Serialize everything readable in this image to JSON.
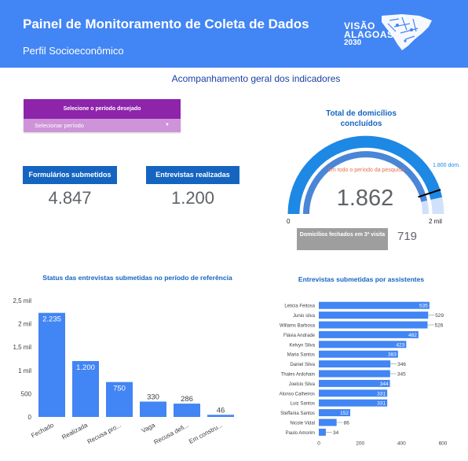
{
  "header": {
    "title": "Painel de Monitoramento de Coleta de Dados",
    "subtitle": "Perfil Socioeconômico",
    "logo_line1": "VISÃO",
    "logo_line2": "ALAGOAS",
    "logo_line3": "2030"
  },
  "main": {
    "section_title": "Acompanhamento geral dos indicadores",
    "period": {
      "heading": "Selecione o período desejado",
      "select_value": "Selecionar período"
    },
    "kpis": [
      {
        "label": "Formulários submetidos",
        "value": "4.847"
      },
      {
        "label": "Entrevistas realizadas",
        "value": "1.200"
      }
    ],
    "gauge": {
      "title": "Total de domicílios concluídos",
      "subtitle": "Em todo o período da pesquisa",
      "value": "1.862",
      "min_label": "0",
      "max_label": "2 mil",
      "target_label": "1.800 dom.",
      "current": 1862,
      "max": 2000,
      "target": 1800,
      "colors": {
        "track": "#d0e2fb",
        "fill": "#1e88e5",
        "inner_track": "#cfe0fa",
        "inner_fill": "#4a86d8"
      }
    },
    "closed_third_visit": {
      "label": "Domicílios fechados em 3ª visita",
      "value": "719"
    }
  },
  "chart_data": [
    {
      "type": "bar",
      "title": "Status das entrevistas submetidas no período de referência",
      "categories": [
        "Fechado",
        "Realizada",
        "Recusa pro...",
        "Vaga",
        "Recusa defi...",
        "Em constru..."
      ],
      "values": [
        2235,
        1200,
        750,
        330,
        286,
        46
      ],
      "value_labels": [
        "2.235",
        "1.200",
        "750",
        "330",
        "286",
        "46"
      ],
      "ytick_labels": [
        "0",
        "500",
        "1 mil",
        "1,5 mil",
        "2 mil",
        "2,5 mil"
      ],
      "yticks": [
        0,
        500,
        1000,
        1500,
        2000,
        2500
      ],
      "ylim": [
        0,
        2500
      ],
      "color": "#4285f4",
      "grid": false
    },
    {
      "type": "bar",
      "orientation": "horizontal",
      "title": "Entrevistas submetidas por assistentes",
      "categories": [
        "Leticia Feitosa",
        "Junio silva",
        "Willams Barbosa",
        "Flávia Andrade",
        "Kelvyn Silva",
        "Maria Santos",
        "Daniel Silva",
        "Thales Ardohain",
        "Joelcio Silva",
        "Alonso Calheiros",
        "Luiz Santos",
        "Steffania Santos",
        "Nicole Vidal",
        "Paulo Amorim"
      ],
      "values": [
        535,
        529,
        526,
        482,
        423,
        383,
        346,
        345,
        344,
        331,
        331,
        152,
        86,
        34
      ],
      "value_labels": [
        "535",
        "529",
        "526",
        "482",
        "423",
        "383",
        "346",
        "345",
        "344",
        "331",
        "331",
        "152",
        "86",
        "34"
      ],
      "xtick_labels": [
        "0",
        "200",
        "400",
        "600"
      ],
      "xticks": [
        0,
        200,
        400,
        600
      ],
      "xlim": [
        0,
        600
      ],
      "color": "#4285f4",
      "grid": false
    }
  ]
}
